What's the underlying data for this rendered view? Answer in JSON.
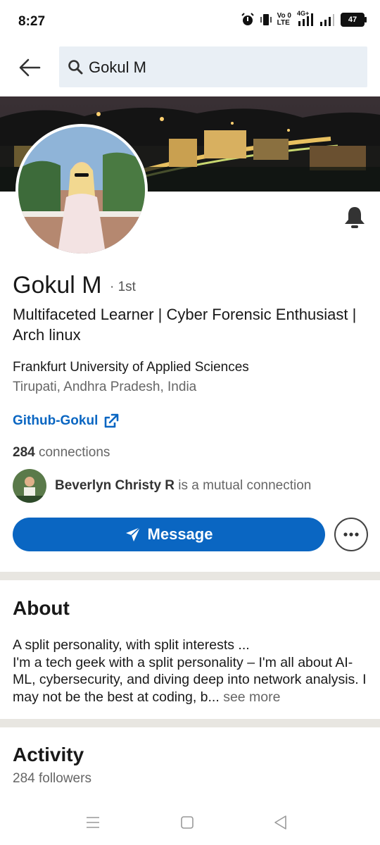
{
  "status_bar": {
    "time": "8:27",
    "net_top": "Vo 0",
    "net_bottom": "LTE",
    "net_type": "4G+",
    "battery": "47"
  },
  "search": {
    "query": "Gokul M"
  },
  "profile": {
    "name": "Gokul M",
    "degree": "· 1st",
    "headline": "Multifaceted Learner | Cyber Forensic Enthusiast | Arch linux",
    "education": "Frankfurt University of Applied Sciences",
    "location": "Tirupati, Andhra Pradesh, India",
    "website": "Github-Gokul",
    "connections_count": "284",
    "connections_label": "connections",
    "mutual_name": "Beverlyn Christy R",
    "mutual_suffix": "is a mutual connection"
  },
  "actions": {
    "message_label": "Message"
  },
  "about": {
    "heading": "About",
    "text": "A split personality, with split interests ...\nI'm a tech geek with a split personality – I'm all about AI-ML, cybersecurity, and diving deep into network analysis. I may not be the best at coding, b...",
    "see_more": "see more"
  },
  "activity": {
    "heading": "Activity",
    "followers": "284 followers"
  },
  "colors": {
    "accent": "#0a66c2",
    "divider": "#e8e6e1",
    "searchbox": "#e9eff5"
  },
  "icons": [
    "back-arrow-icon",
    "search-icon",
    "bell-icon",
    "external-link-icon",
    "send-icon",
    "more-icon",
    "recent-apps-icon",
    "home-icon",
    "back-nav-icon"
  ]
}
